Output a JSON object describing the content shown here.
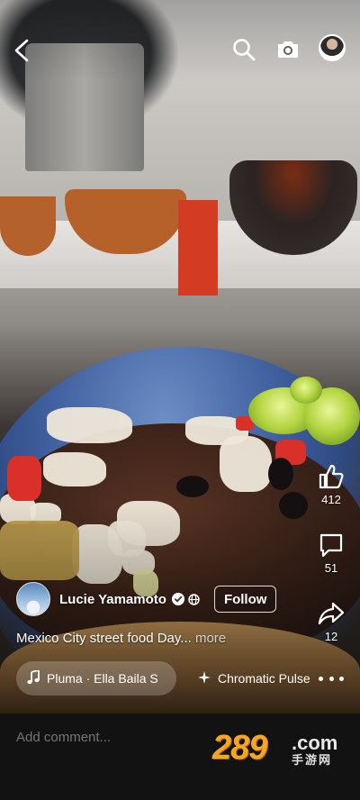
{
  "post": {
    "author_name": "Lucie Yamamoto",
    "follow_label": "Follow",
    "caption": "Mexico City street food Day...",
    "caption_more": "more"
  },
  "actions": {
    "likes": "412",
    "comments": "51",
    "shares": "12"
  },
  "music": {
    "track": "Pluma · Ella Baila S",
    "effect": "Chromatic Pulse"
  },
  "comment_bar": {
    "placeholder": "Add comment..."
  },
  "watermark": {
    "number": "289",
    "com": ".com",
    "chinese": "手游网"
  },
  "colors": {
    "comment_bar_bg": "#121212",
    "watermark_orange": "#f5a623"
  },
  "icons": [
    "back-arrow-icon",
    "search-icon",
    "camera-icon",
    "profile-avatar",
    "thumbs-up-icon",
    "comment-bubble-icon",
    "share-arrow-icon",
    "music-note-icon",
    "sparkle-icon",
    "more-dots-icon",
    "verified-icon",
    "globe-icon"
  ]
}
